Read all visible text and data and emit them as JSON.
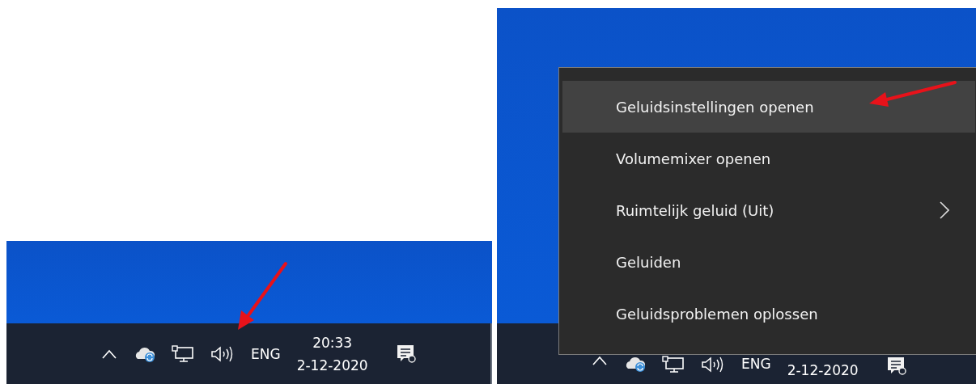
{
  "left_panel": {
    "taskbar": {
      "language": "ENG",
      "time": "20:33",
      "date": "2-12-2020"
    }
  },
  "right_panel": {
    "taskbar": {
      "language": "ENG",
      "date": "2-12-2020"
    },
    "context_menu": {
      "items": [
        {
          "label": "Geluidsinstellingen openen",
          "selected": true,
          "has_submenu": false
        },
        {
          "label": "Volumemixer openen",
          "selected": false,
          "has_submenu": false
        },
        {
          "label": "Ruimtelijk geluid (Uit)",
          "selected": false,
          "has_submenu": true
        },
        {
          "label": "Geluiden",
          "selected": false,
          "has_submenu": false
        },
        {
          "label": "Geluidsproblemen oplossen",
          "selected": false,
          "has_submenu": false
        }
      ]
    }
  }
}
